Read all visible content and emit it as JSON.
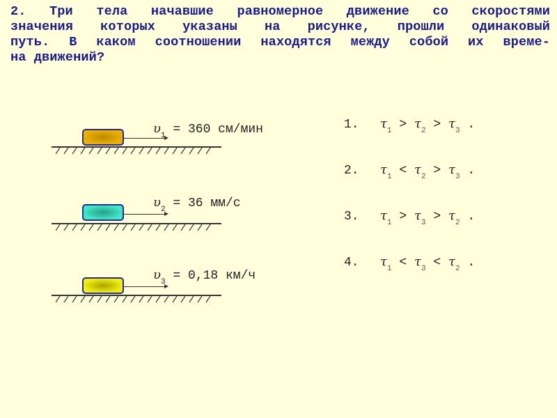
{
  "question": {
    "lines": [
      "2. Три тела начавшие равномерное движение со скоростями",
      "значения которых указаны на рисунке, прошли одинаковый",
      "путь. В каком соотношении находятся между собой их време-",
      "на движений?"
    ]
  },
  "scenes": [
    {
      "symbol": "υ",
      "index": "1",
      "text": " = 360 см/мин",
      "block_color": "#EDB000",
      "block_center": "#B98A00"
    },
    {
      "symbol": "υ",
      "index": "2",
      "text": " = 36 мм/с",
      "block_color": "#3EE8C8",
      "block_center": "#2A9C84"
    },
    {
      "symbol": "υ",
      "index": "3",
      "text": " = 0,18 км/ч",
      "block_color": "#EEEE10",
      "block_center": "#A9A200"
    }
  ],
  "answers": [
    {
      "num": "1.",
      "parts": [
        [
          "τ",
          "1",
          " > "
        ],
        [
          "τ",
          "2",
          " > "
        ],
        [
          "τ",
          "3",
          " ."
        ]
      ]
    },
    {
      "num": "2.",
      "parts": [
        [
          "τ",
          "1",
          " < "
        ],
        [
          "τ",
          "2",
          " > "
        ],
        [
          "τ",
          "3",
          " ."
        ]
      ]
    },
    {
      "num": "3.",
      "parts": [
        [
          "τ",
          "1",
          " > "
        ],
        [
          "τ",
          "3",
          " > "
        ],
        [
          "τ",
          "2",
          " ."
        ]
      ]
    },
    {
      "num": "4.",
      "parts": [
        [
          "τ",
          "1",
          " < "
        ],
        [
          "τ",
          "3",
          " < "
        ],
        [
          "τ",
          "2",
          " ."
        ]
      ]
    }
  ],
  "colors": {
    "background": "#FFFFDC",
    "question_text": "#1B1B8A",
    "body_text": "#222222"
  }
}
